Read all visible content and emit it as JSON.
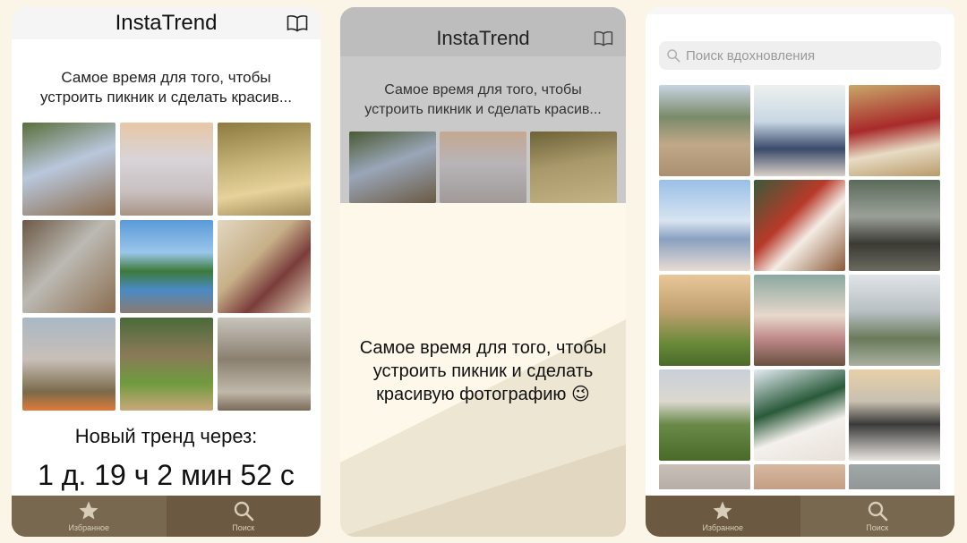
{
  "app": {
    "title": "InstaTrend"
  },
  "screen1": {
    "tagline_line1": "Самое время для того, чтобы",
    "tagline_line2": "устроить пикник и сделать красив...",
    "countdown_label": "Новый тренд через:",
    "countdown_value": "1 д. 19 ч 2 мин 52 с"
  },
  "screen2": {
    "tagline_line1": "Самое время для того, чтобы",
    "tagline_line2": "устроить пикник и сделать красив...",
    "message_line1": "Самое время для того, чтобы",
    "message_line2": "устроить пикник и сделать",
    "message_line3": "красивую фотографию 😉"
  },
  "screen3": {
    "search_placeholder": "Поиск вдохновления"
  },
  "tabbar": {
    "favorites_label": "Избранное",
    "search_label": "Поиск"
  },
  "colors": {
    "tabbar": "#6b5a41",
    "tab_active": "#786850",
    "background": "#faf5e6"
  },
  "icons": {
    "bookmark": "open-book-icon",
    "favorites": "star-icon",
    "search": "magnifier-icon"
  }
}
